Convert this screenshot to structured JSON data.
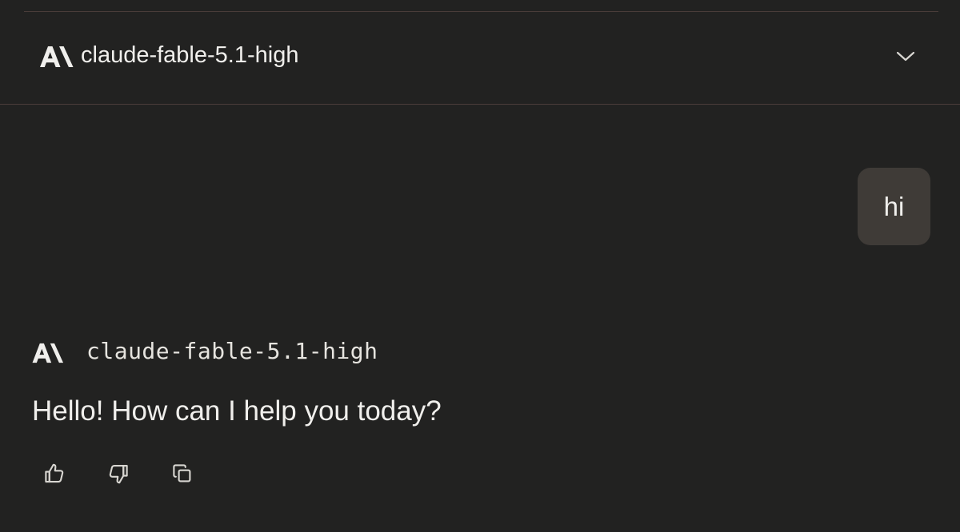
{
  "header": {
    "model_name": "claude-fable-5.1-high",
    "logo_icon": "anthropic-logo-icon",
    "dropdown_icon": "chevron-down-icon"
  },
  "conversation": {
    "user_message": "hi",
    "assistant": {
      "model_name": "claude-fable-5.1-high",
      "message": "Hello! How can I help you today?"
    }
  },
  "message_actions": [
    {
      "name": "thumbs-up-icon"
    },
    {
      "name": "thumbs-down-icon"
    },
    {
      "name": "copy-icon"
    }
  ],
  "colors": {
    "background": "#222221",
    "divider": "#4a3d3a",
    "user_bubble": "#3f3b37",
    "text": "#f0efec",
    "icon": "#d8d6d1"
  }
}
